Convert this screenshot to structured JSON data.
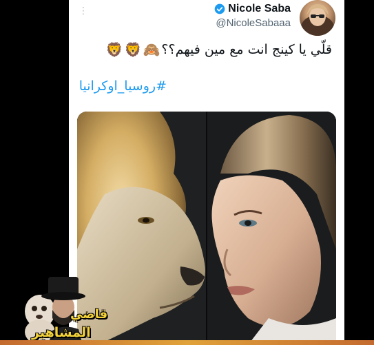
{
  "tweet": {
    "author": {
      "display_name": "Nicole Saba",
      "handle": "@NicoleSabaaa",
      "verified": true
    },
    "text": "قلّي يا كينج انت مع مين فيهم؟؟",
    "emojis": [
      "🙈",
      "🦁",
      "🦁"
    ],
    "hashtag": "#روسيا_اوكرانيا",
    "more_icon": "more-vertical-icon"
  },
  "overlay": {
    "line1": "قاضي",
    "line2": "المشاهير"
  },
  "colors": {
    "card": "#ffffff",
    "text": "#0f1419",
    "handle": "#536471",
    "hashtag": "#1d9bf0",
    "verified": "#1d9bf0",
    "overlay_text": "#f3d23a"
  }
}
